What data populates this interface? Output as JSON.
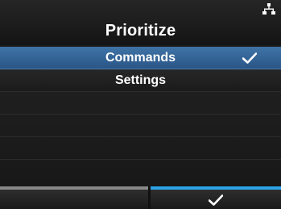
{
  "header": {
    "title": "Prioritize",
    "status_icon": "network-icon"
  },
  "menu": {
    "items": [
      {
        "label": "Commands",
        "selected": true,
        "check_icon": "check-icon"
      },
      {
        "label": "Settings",
        "selected": false
      }
    ]
  },
  "footer": {
    "left_key": {
      "label": ""
    },
    "right_key": {
      "icon": "check-icon"
    }
  },
  "colors": {
    "selection": "#3a6ea5",
    "accent_bar": "#2ba3e6",
    "inactive_bar": "#888888"
  }
}
